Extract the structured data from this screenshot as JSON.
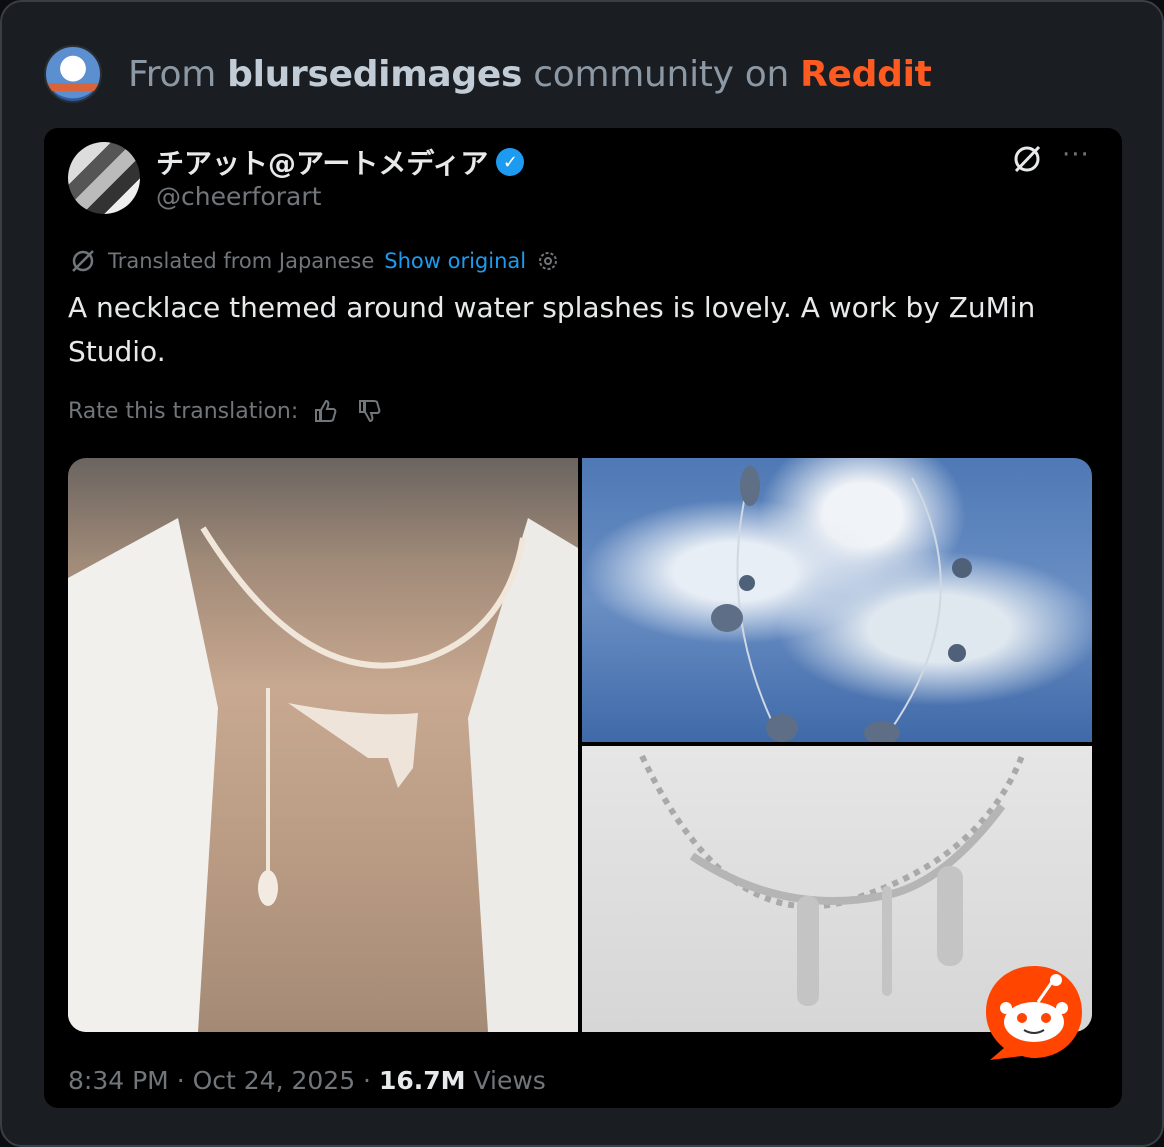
{
  "header": {
    "prefix": "From",
    "community": "blursedimages",
    "middle": "community on",
    "platform": "Reddit"
  },
  "tweet": {
    "display_name": "チアット@アートメディア",
    "handle": "@cheerforart",
    "translated_label": "Translated from Japanese",
    "show_original": "Show original",
    "text": "A necklace themed around water splashes is lovely. A work by ZuMin Studio.",
    "rate_label": "Rate this translation:",
    "time": "8:34 PM",
    "date": "Oct 24, 2025",
    "views_count": "16.7M",
    "views_label": "Views"
  },
  "colors": {
    "reddit": "#ff5a1f",
    "link": "#1d9bf0",
    "verified": "#1d9bf0",
    "muted": "#71767b"
  },
  "icons": [
    "subreddit-avatar-icon",
    "verified-icon",
    "grok-icon",
    "more-icon",
    "translate-icon",
    "settings-icon",
    "thumbs-up-icon",
    "thumbs-down-icon",
    "reddit-snoo-icon"
  ]
}
